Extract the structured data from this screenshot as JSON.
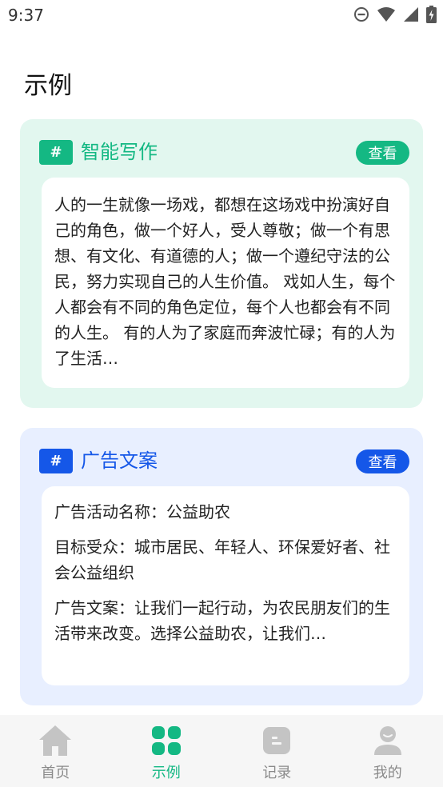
{
  "status_bar": {
    "time": "9:37",
    "icons": [
      "do-not-disturb-icon",
      "wifi-icon",
      "cell-signal-icon",
      "battery-charging-icon"
    ]
  },
  "page": {
    "title": "示例"
  },
  "cards": [
    {
      "badge": "#",
      "title": "智能写作",
      "view_label": "查看",
      "accent": "#14b883",
      "background": "#e2f7ef",
      "body": "人的一生就像一场戏，都想在这场戏中扮演好自己的角色，做一个好人，受人尊敬；做一个有思想、有文化、有道德的人；做一个遵纪守法的公民，努力实现自己的人生价值。 戏如人生，每个人都会有不同的角色定位，每个人也都会有不同的人生。 有的人为了家庭而奔波忙碌；有的人为了生活…"
    },
    {
      "badge": "#",
      "title": "广告文案",
      "view_label": "查看",
      "accent": "#1557e8",
      "background": "#e8efff",
      "paragraphs": [
        "广告活动名称：公益助农",
        "目标受众：城市居民、年轻人、环保爱好者、社会公益组织",
        "广告文案：让我们一起行动，为农民朋友们的生活带来改变。选择公益助农，让我们…"
      ]
    }
  ],
  "bottom_nav": {
    "active_color": "#14b883",
    "items": [
      {
        "label": "首页",
        "icon": "home-icon",
        "active": false
      },
      {
        "label": "示例",
        "icon": "grid-icon",
        "active": true
      },
      {
        "label": "记录",
        "icon": "record-icon",
        "active": false
      },
      {
        "label": "我的",
        "icon": "user-icon",
        "active": false
      }
    ]
  }
}
